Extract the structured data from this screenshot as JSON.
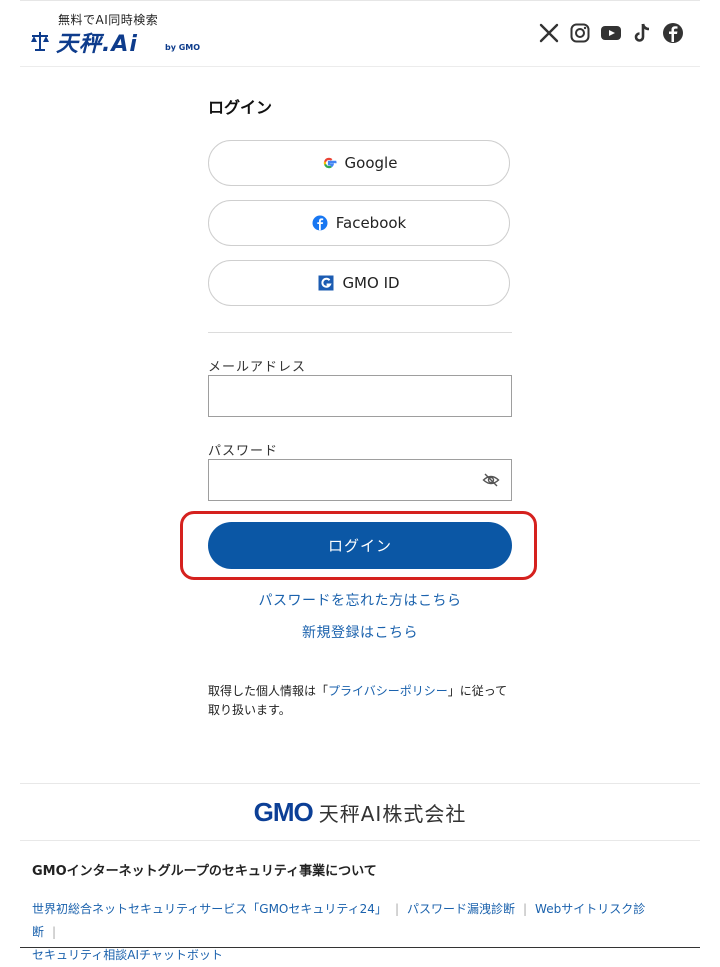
{
  "header": {
    "logo_tagline": "無料でAI同時検索",
    "logo_main": "天秤.Ai",
    "logo_by": "by GMO",
    "social_icons": [
      "x-icon",
      "instagram-icon",
      "youtube-icon",
      "tiktok-icon",
      "facebook-icon"
    ]
  },
  "login": {
    "title": "ログイン",
    "sso": [
      {
        "label": "Google",
        "icon": "google-icon"
      },
      {
        "label": "Facebook",
        "icon": "facebook-icon"
      },
      {
        "label": "GMO ID",
        "icon": "gmo-id-icon"
      }
    ],
    "email_label": "メールアドレス",
    "email_value": "",
    "password_label": "パスワード",
    "password_value": "",
    "submit_label": "ログイン",
    "forgot_link": "パスワードを忘れた方はこちら",
    "register_link": "新規登録はこちら",
    "privacy_prefix": "取得した個人情報は「",
    "privacy_link": "プライバシーポリシー",
    "privacy_suffix": "」に従って取り扱います。",
    "highlight_color": "#d5211e",
    "accent_color": "#0b57a5"
  },
  "footer": {
    "company_logo_gmo": "GMO",
    "company_name": "天秤AI株式会社",
    "heading": "GMOインターネットグループのセキュリティ事業について",
    "links": [
      "世界初総合ネットセキュリティサービス「GMOセキュリティ24」",
      "パスワード漏洩診断",
      "Webサイトリスク診断",
      "セキュリティ相談AIチャットボット"
    ]
  }
}
